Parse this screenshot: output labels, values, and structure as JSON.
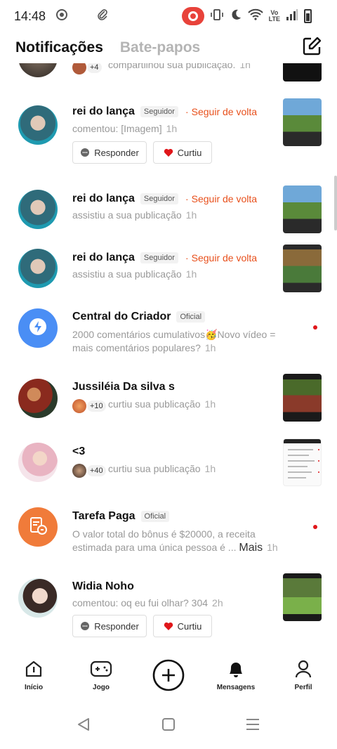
{
  "status_bar": {
    "time": "14:48"
  },
  "header": {
    "tabs": [
      {
        "label": "Notificações",
        "active": true
      },
      {
        "label": "Bate-papos",
        "active": false
      }
    ]
  },
  "notifications": [
    {
      "sub": "compartilhou sua publicação.",
      "time": "1h",
      "count": "+4"
    },
    {
      "name": "rei do lança",
      "badge": "Seguidor",
      "follow": "Seguir de volta",
      "sub": "comentou: [Imagem]",
      "time": "1h",
      "reply": "Responder",
      "like": "Curtiu"
    },
    {
      "name": "rei do lança",
      "badge": "Seguidor",
      "follow": "Seguir de volta",
      "sub": "assistiu a sua publicação",
      "time": "1h"
    },
    {
      "name": "rei do lança",
      "badge": "Seguidor",
      "follow": "Seguir de volta",
      "sub": "assistiu a sua publicação",
      "time": "1h"
    },
    {
      "name": "Central do Criador",
      "badge": "Oficial",
      "sub_line1": "2000 comentários cumulativos🥳Novo vídeo =",
      "sub_line2": "mais comentários populares?",
      "time": "1h"
    },
    {
      "name": "Jussiléia Da silva s",
      "count": "+10",
      "sub": "curtiu sua publicação",
      "time": "1h"
    },
    {
      "name": "<3",
      "count": "+40",
      "sub": "curtiu sua publicação",
      "time": "1h"
    },
    {
      "name": "Tarefa Paga",
      "badge": "Oficial",
      "sub_line1": "O valor total do bônus é $20000, a receita",
      "sub_line2": "estimada para uma única pessoa é ...",
      "more": "Mais",
      "time": "1h"
    },
    {
      "name": "Widia Noho",
      "sub": "comentou: oq eu fui olhar? 304",
      "time": "2h",
      "reply": "Responder",
      "like": "Curtiu"
    }
  ],
  "bottom_nav": [
    {
      "label": "Início"
    },
    {
      "label": "Jogo"
    },
    {
      "label": ""
    },
    {
      "label": "Mensagens",
      "active": true
    },
    {
      "label": "Perfil"
    }
  ],
  "colors": {
    "accent": "#e8501c",
    "like": "#e0161a",
    "official_blue": "#4a8ef5",
    "official_orange": "#f07b3a"
  }
}
